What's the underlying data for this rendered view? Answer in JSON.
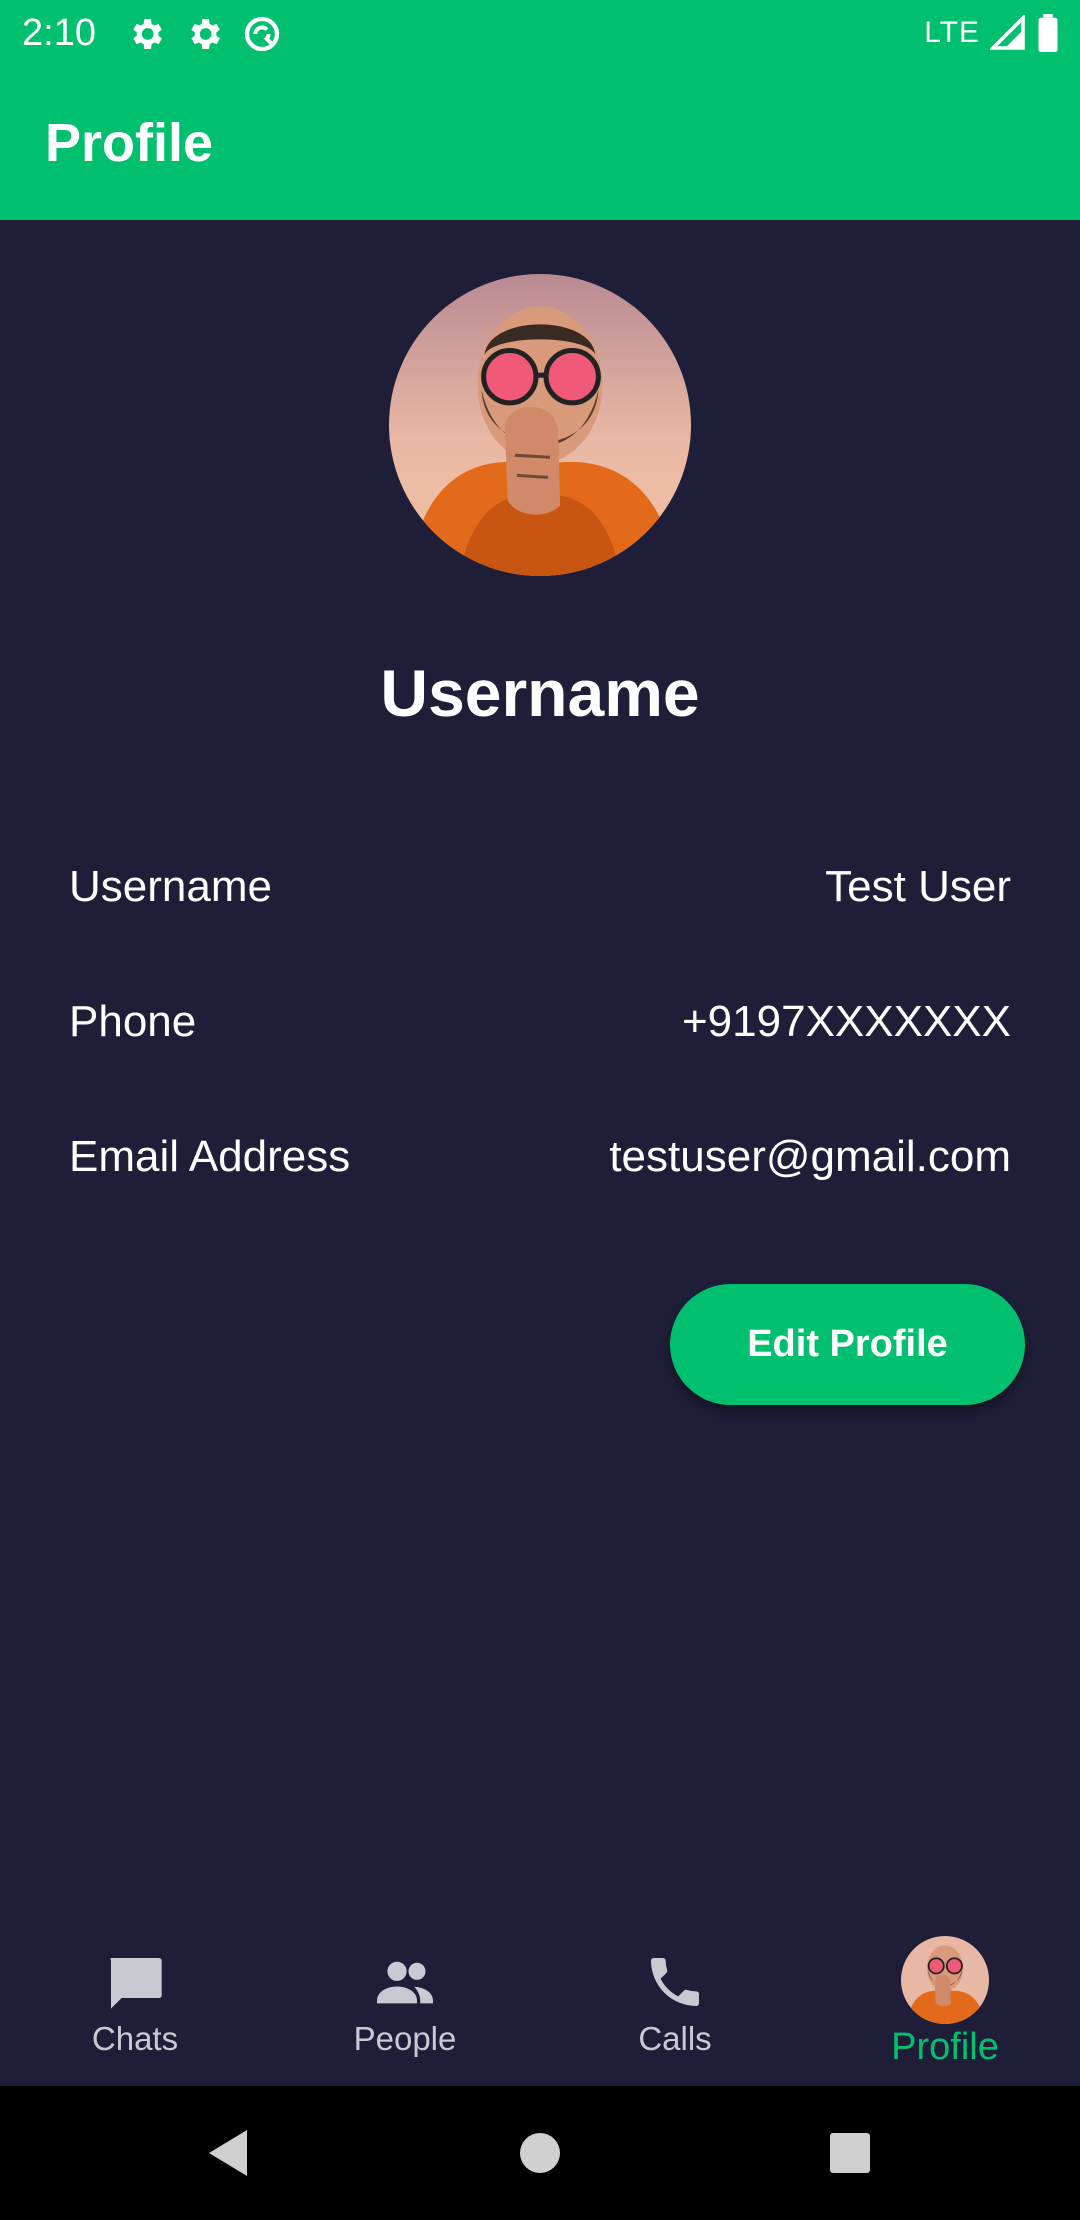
{
  "status_bar": {
    "time": "2:10",
    "network": "LTE",
    "icons": [
      "gear-icon",
      "gear-icon",
      "sync-icon",
      "signal-icon",
      "battery-icon"
    ]
  },
  "app_bar": {
    "title": "Profile"
  },
  "profile": {
    "display_name": "Username",
    "fields": [
      {
        "label": "Username",
        "value": "Test User"
      },
      {
        "label": "Phone",
        "value": "+9197XXXXXXX"
      },
      {
        "label": "Email Address",
        "value": "testuser@gmail.com"
      }
    ],
    "edit_button_label": "Edit Profile"
  },
  "bottom_nav": {
    "items": [
      {
        "label": "Chats",
        "icon": "chat-icon"
      },
      {
        "label": "People",
        "icon": "people-icon"
      },
      {
        "label": "Calls",
        "icon": "phone-icon"
      },
      {
        "label": "Profile",
        "icon": "avatar"
      }
    ],
    "active": "Profile"
  },
  "colors": {
    "accent": "#00c06f",
    "background": "#1e1e38",
    "inactive": "#c9c9d2"
  }
}
